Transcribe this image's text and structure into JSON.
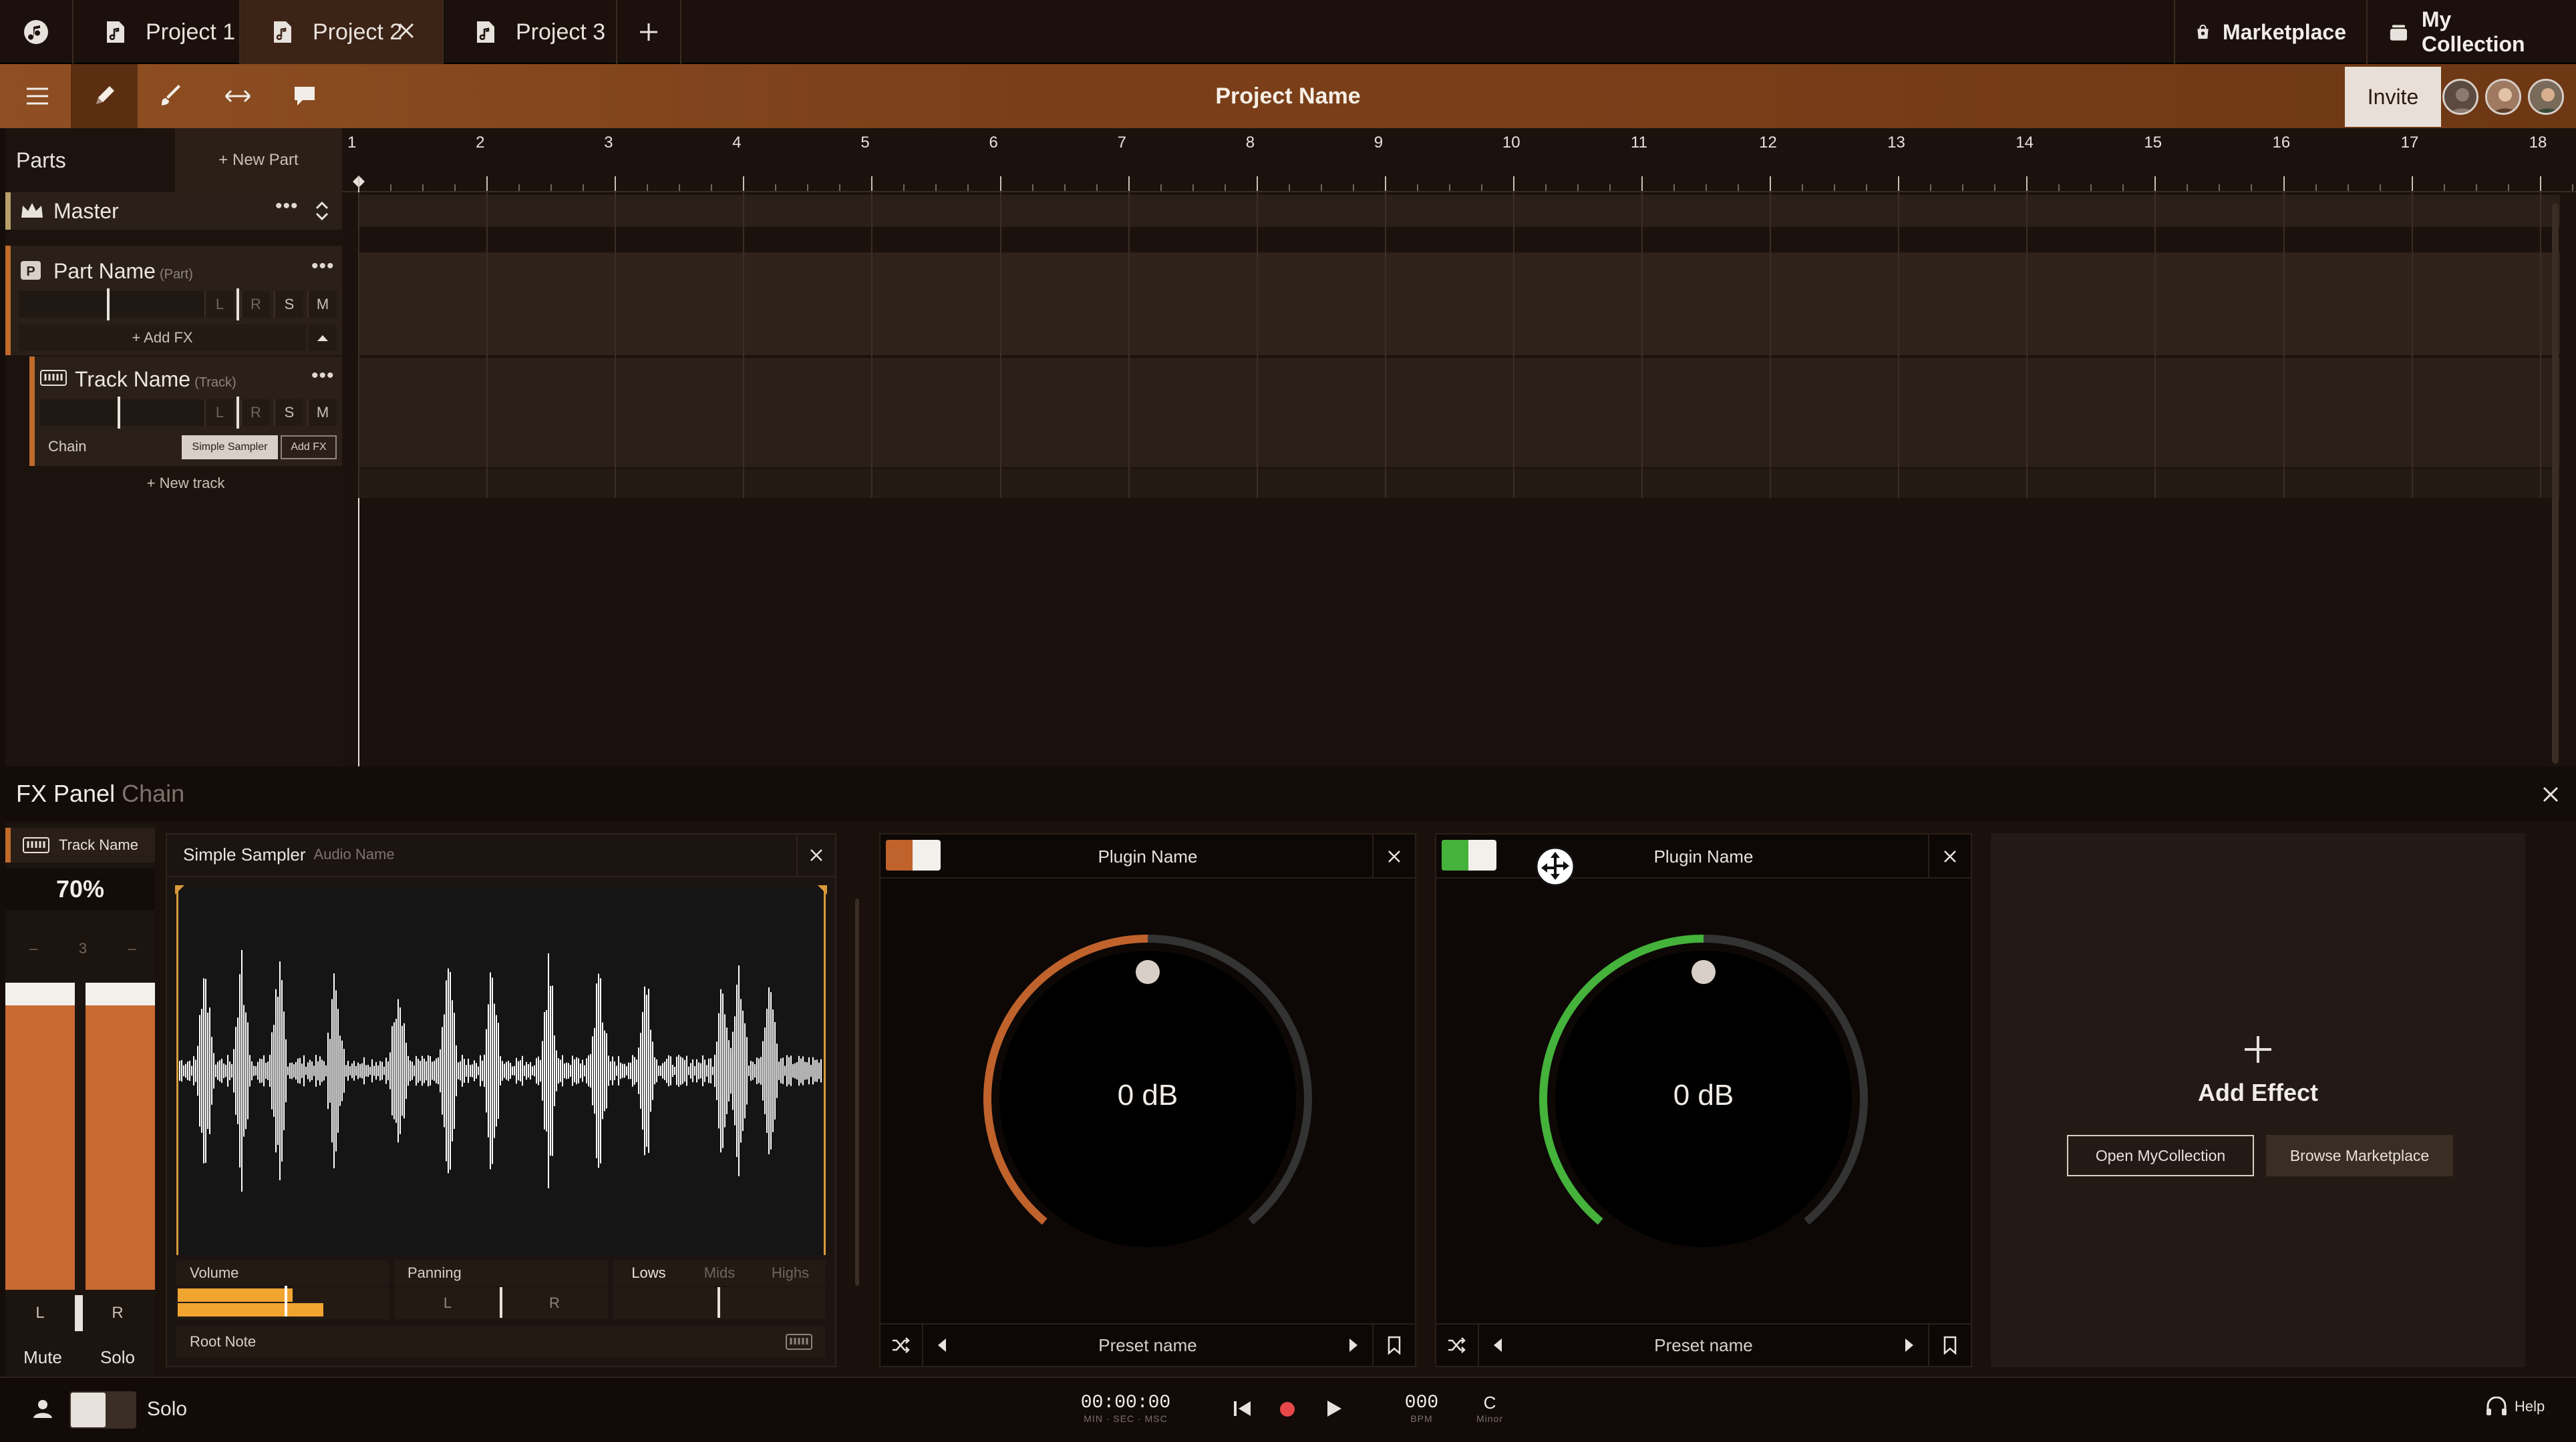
{
  "tabs": [
    {
      "label": "Project 1"
    },
    {
      "label": "Project 2"
    },
    {
      "label": "Project 3"
    }
  ],
  "top_right": {
    "marketplace": "Marketplace",
    "collection": "My Collection"
  },
  "toolbar": {
    "project_name": "Project Name",
    "invite": "Invite"
  },
  "parts": {
    "title": "Parts",
    "new_part": "+ New Part",
    "master": {
      "label": "Master"
    },
    "part": {
      "label": "Part Name",
      "sub": "(Part)",
      "add_fx": "+ Add FX"
    },
    "track": {
      "label": "Track Name",
      "sub": "(Track)",
      "chain": "Chain",
      "chip1": "Simple Sampler",
      "chip2": "Add FX"
    },
    "new_track": "+ New track",
    "btn_l": "L",
    "btn_r": "R",
    "btn_s": "S",
    "btn_m": "M"
  },
  "ruler": [
    "1",
    "2",
    "3",
    "4",
    "5",
    "6",
    "7",
    "8",
    "9",
    "10",
    "11",
    "12",
    "13",
    "14",
    "15",
    "16",
    "17",
    "18"
  ],
  "fx": {
    "title": "FX Panel",
    "sub": "Chain",
    "mini": {
      "track": "Track Name",
      "percent": "70%",
      "tick": "3",
      "l": "L",
      "r": "R",
      "mute": "Mute",
      "solo": "Solo",
      "level": 0.87
    },
    "sampler": {
      "title": "Simple Sampler",
      "sub": "Audio Name",
      "volume": "Volume",
      "panning": "Panning",
      "lows": "Lows",
      "mids": "Mids",
      "highs": "Highs",
      "pan_l": "L",
      "pan_r": "R",
      "root_note": "Root Note"
    },
    "plugin1": {
      "name": "Plugin Name",
      "value": "0 dB",
      "preset": "Preset name",
      "accent": "#c0622c"
    },
    "plugin2": {
      "name": "Plugin Name",
      "value": "0 dB",
      "preset": "Preset name",
      "accent": "#44b23b"
    },
    "add_effect": {
      "title": "Add Effect",
      "open": "Open MyCollection",
      "browse": "Browse Marketplace"
    }
  },
  "bottom": {
    "solo": "Solo",
    "time": "00:00:00",
    "time_sub": "MIN · SEC · MSC",
    "bpm": "000",
    "bpm_sub": "BPM",
    "key": "C",
    "key_sub": "Minor",
    "help": "Help"
  }
}
